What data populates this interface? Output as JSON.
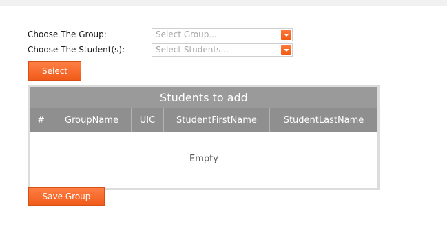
{
  "form": {
    "group_label": "Choose The Group:",
    "group_placeholder": "Select Group...",
    "student_label": "Choose The Student(s):",
    "student_placeholder": "Select Students..."
  },
  "buttons": {
    "select_label": "Select",
    "save_label": "Save Group"
  },
  "table": {
    "title": "Students to add",
    "columns": [
      "#",
      "GroupName",
      "UIC",
      "StudentFirstName",
      "StudentLastName"
    ],
    "empty_text": "Empty"
  },
  "colors": {
    "accent": "#f26522",
    "table_header": "#8f8f8f"
  }
}
